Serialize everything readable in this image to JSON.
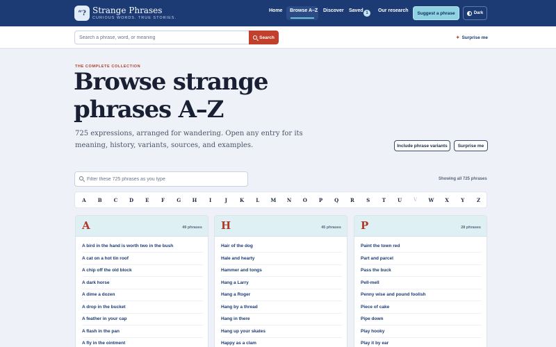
{
  "brand": {
    "badge": "“?",
    "title": "Strange Phrases",
    "tagline": "CURIOUS WORDS. TRUE STORIES."
  },
  "nav": {
    "items": [
      "Home",
      "Browse A–Z",
      "Discover",
      "Saved",
      "Our research"
    ],
    "active": "Browse A–Z",
    "saved_count": "1",
    "suggest_label": "Suggest a phrase",
    "dark_label": "Dark"
  },
  "search": {
    "placeholder": "Search a phrase, word, or meaning",
    "button_label": "Search",
    "surprise_label": "Surprise me"
  },
  "hero": {
    "eyebrow": "THE COMPLETE COLLECTION",
    "title": "Browse strange phrases A–Z",
    "subtitle": "725 expressions, arranged for wandering. Open any entry for its meaning, history, variants, sources, and examples.",
    "variants_label": "Include phrase variants",
    "surprise_label": "Surprise me"
  },
  "filter": {
    "placeholder": "Filter these 725 phrases as you type",
    "showing": "Showing all 725 phrases"
  },
  "alphabet": [
    "A",
    "B",
    "C",
    "D",
    "E",
    "F",
    "G",
    "H",
    "I",
    "J",
    "K",
    "L",
    "M",
    "N",
    "O",
    "P",
    "Q",
    "R",
    "S",
    "T",
    "U",
    "V",
    "W",
    "X",
    "Y",
    "Z"
  ],
  "alphabet_disabled": [
    "V"
  ],
  "columns": [
    {
      "letter": "A",
      "count": "49 phrases",
      "entries": [
        "A bird in the hand is worth two in the bush",
        "A cat on a hot tin roof",
        "A chip off the old block",
        "A dark horse",
        "A dime a dozen",
        "A drop in the bucket",
        "A feather in your cap",
        "A flash in the pan",
        "A fly in the ointment"
      ]
    },
    {
      "letter": "H",
      "count": "45 phrases",
      "entries": [
        "Hair of the dog",
        "Hale and hearty",
        "Hammer and tongs",
        "Hang a Larry",
        "Hang a Roger",
        "Hang by a thread",
        "Hang in there",
        "Hang up your skates",
        "Happy as a clam"
      ]
    },
    {
      "letter": "P",
      "count": "28 phrases",
      "entries": [
        "Paint the town red",
        "Part and parcel",
        "Pass the buck",
        "Pell-mell",
        "Penny wise and pound foolish",
        "Piece of cake",
        "Pipe down",
        "Play hooky",
        "Play it by ear"
      ]
    }
  ],
  "colors": {
    "header": "#1c3a73",
    "accent": "#c2402b",
    "suggest": "#8fd3e3",
    "column_head": "#dff0f5"
  },
  "icons": [
    "quote-logo-icon",
    "half-moon-icon",
    "search-icon",
    "sparkle-icon"
  ]
}
